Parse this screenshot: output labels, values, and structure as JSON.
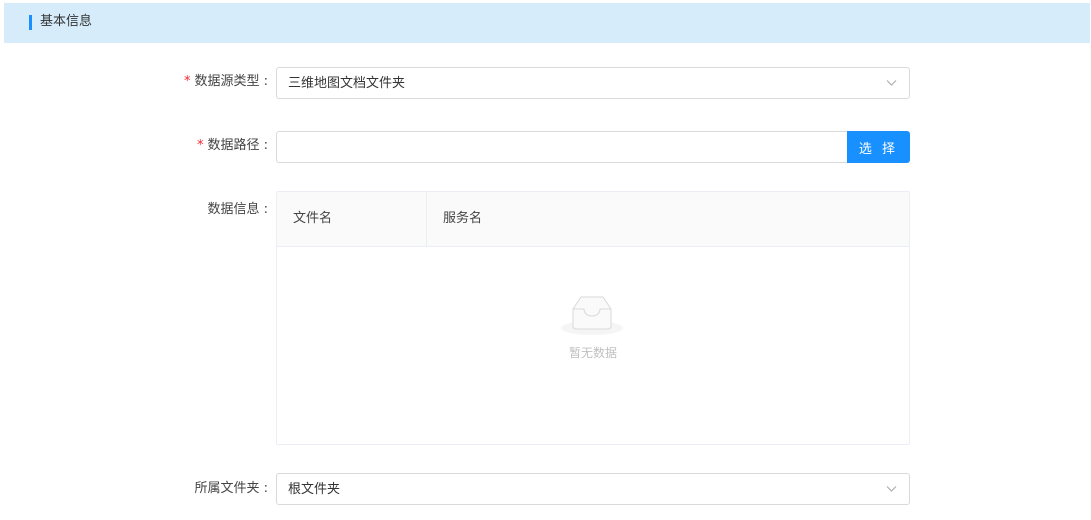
{
  "section": {
    "title": "基本信息"
  },
  "form": {
    "source_type": {
      "required_mark": "*",
      "label": "数据源类型 :",
      "value": "三维地图文档文件夹"
    },
    "data_path": {
      "required_mark": "*",
      "label": "数据路径 :",
      "value": "",
      "button_label": "选 择"
    },
    "data_info": {
      "label": "数据信息 :",
      "columns": [
        "文件名",
        "服务名"
      ],
      "rows": [],
      "empty_text": "暂无数据"
    },
    "folder": {
      "label": "所属文件夹 :",
      "value": "根文件夹"
    }
  },
  "colors": {
    "accent": "#1890ff",
    "header_bg": "#d6ecfb",
    "required": "#f5222d"
  }
}
